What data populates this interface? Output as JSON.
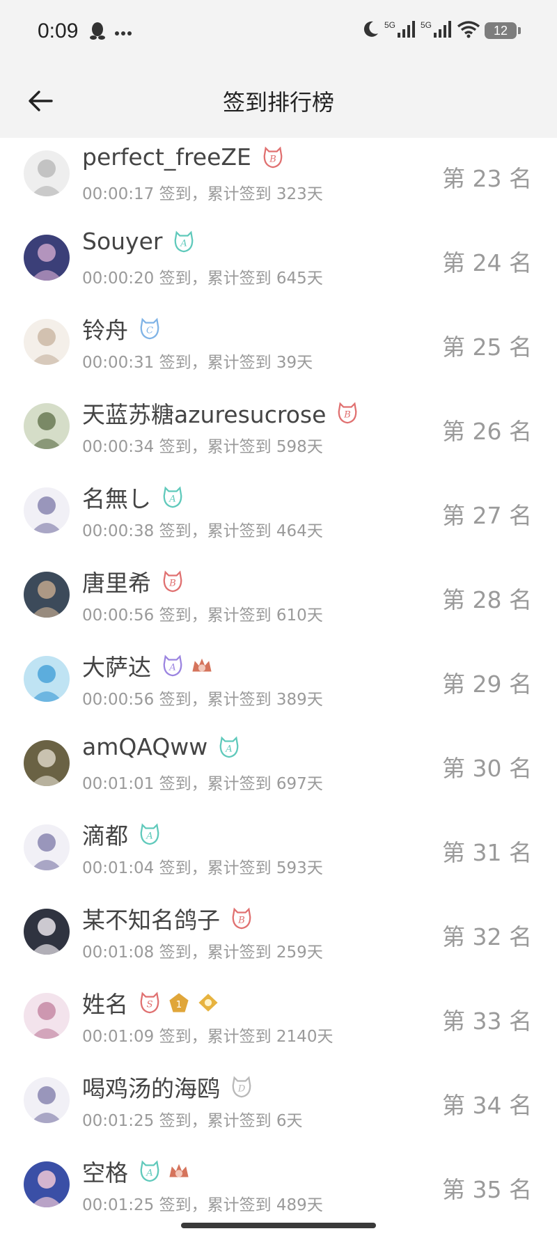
{
  "status_bar": {
    "time": "0:09",
    "battery": "12",
    "signal1": "5G",
    "signal2": "5G",
    "wifi_label": "6"
  },
  "header": {
    "title": "签到排行榜"
  },
  "list": [
    {
      "name": "perfect_freeZE",
      "meta": "00:00:17 签到，累计签到 323天",
      "rank": "第 23 名",
      "badges": [
        {
          "kind": "b",
          "color": "#e07070"
        }
      ],
      "avatar": {
        "bg": "#eeeeee",
        "fg": "#bbbbbb"
      }
    },
    {
      "name": "Souyer",
      "meta": "00:00:20 签到，累计签到 645天",
      "rank": "第 24 名",
      "badges": [
        {
          "kind": "a",
          "color": "#5fc9bb"
        }
      ],
      "avatar": {
        "bg": "#3b3f78",
        "fg": "#c9a3c9"
      }
    },
    {
      "name": "铃舟",
      "meta": "00:00:31 签到，累计签到 39天",
      "rank": "第 25 名",
      "badges": [
        {
          "kind": "c",
          "color": "#7fb3e6"
        }
      ],
      "avatar": {
        "bg": "#f4efe9",
        "fg": "#cbb9a6"
      }
    },
    {
      "name": "天蓝苏糖azuresucrose",
      "meta": "00:00:34 签到，累计签到 598天",
      "rank": "第 26 名",
      "badges": [
        {
          "kind": "b",
          "color": "#e07070"
        }
      ],
      "avatar": {
        "bg": "#d5ddc8",
        "fg": "#6a7a55"
      }
    },
    {
      "name": "名無し",
      "meta": "00:00:38 签到，累计签到 464天",
      "rank": "第 27 名",
      "badges": [
        {
          "kind": "a",
          "color": "#5fc9bb"
        }
      ],
      "avatar": {
        "bg": "#f1f0f6",
        "fg": "#8a86b0"
      }
    },
    {
      "name": "唐里希",
      "meta": "00:00:56 签到，累计签到 610天",
      "rank": "第 28 名",
      "badges": [
        {
          "kind": "b",
          "color": "#e07070"
        }
      ],
      "avatar": {
        "bg": "#3c4a5a",
        "fg": "#bfa68d"
      }
    },
    {
      "name": "大萨达",
      "meta": "00:00:56 签到，累计签到 389天",
      "rank": "第 29 名",
      "badges": [
        {
          "kind": "a",
          "color": "#9b84e0"
        },
        {
          "kind": "crown",
          "color": "#d0654a"
        }
      ],
      "avatar": {
        "bg": "#bfe3f3",
        "fg": "#4aa3d8"
      }
    },
    {
      "name": "amQAQww",
      "meta": "00:01:01 签到，累计签到 697天",
      "rank": "第 30 名",
      "badges": [
        {
          "kind": "a",
          "color": "#5fc9bb"
        }
      ],
      "avatar": {
        "bg": "#6a6244",
        "fg": "#d9d3c3"
      }
    },
    {
      "name": "滴都",
      "meta": "00:01:04 签到，累计签到 593天",
      "rank": "第 31 名",
      "badges": [
        {
          "kind": "a",
          "color": "#5fc9bb"
        }
      ],
      "avatar": {
        "bg": "#f1f0f6",
        "fg": "#8a86b0"
      }
    },
    {
      "name": "某不知名鸽子",
      "meta": "00:01:08 签到，累计签到 259天",
      "rank": "第 32 名",
      "badges": [
        {
          "kind": "b",
          "color": "#e07070"
        }
      ],
      "avatar": {
        "bg": "#2f3340",
        "fg": "#e8e4ea"
      }
    },
    {
      "name": "姓名",
      "meta": "00:01:09 签到，累计签到 2140天",
      "rank": "第 33 名",
      "badges": [
        {
          "kind": "s",
          "color": "#e07070"
        },
        {
          "kind": "gold",
          "color": "#e0a63a"
        },
        {
          "kind": "gem",
          "color": "#e7b33f"
        }
      ],
      "avatar": {
        "bg": "#f3e3ec",
        "fg": "#c58aa6"
      }
    },
    {
      "name": "喝鸡汤的海鸥",
      "meta": "00:01:25 签到，累计签到 6天",
      "rank": "第 34 名",
      "badges": [
        {
          "kind": "d",
          "color": "#b8b8b8"
        }
      ],
      "avatar": {
        "bg": "#f1f0f6",
        "fg": "#8a86b0"
      }
    },
    {
      "name": "空格",
      "meta": "00:01:25 签到，累计签到 489天",
      "rank": "第 35 名",
      "badges": [
        {
          "kind": "a",
          "color": "#5fc9bb"
        },
        {
          "kind": "crown",
          "color": "#d0654a"
        }
      ],
      "avatar": {
        "bg": "#3a4fa6",
        "fg": "#f0c7d6"
      }
    }
  ]
}
